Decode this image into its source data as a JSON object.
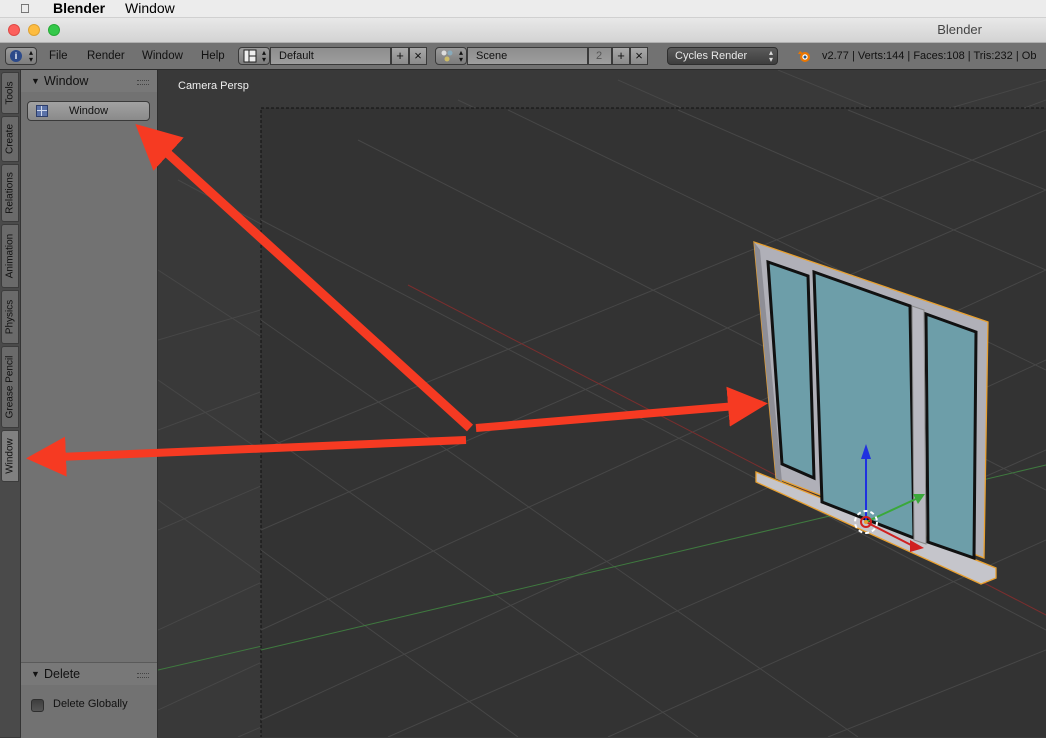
{
  "mac_menubar": {
    "app_name": "Blender",
    "menu_window": "Window"
  },
  "window": {
    "title": "Blender"
  },
  "info_header": {
    "menus": [
      "File",
      "Render",
      "Window",
      "Help"
    ],
    "layout_name": "Default",
    "scene_name": "Scene",
    "scene_users": "2",
    "render_engine": "Cycles Render",
    "stats": "v2.77 | Verts:144 | Faces:108 | Tris:232 | Ob"
  },
  "tool_tabs": [
    "Tools",
    "Create",
    "Relations",
    "Animation",
    "Physics",
    "Grease Pencil",
    "Window"
  ],
  "active_tab": "Window",
  "window_panel": {
    "title": "Window",
    "button_label": "Window"
  },
  "delete_panel": {
    "title": "Delete",
    "option_label": "Delete Globally",
    "option_checked": false
  },
  "viewport": {
    "label": "Camera Persp"
  },
  "colors": {
    "viewport_bg": "#393939",
    "panel_bg": "#727272",
    "glass": "#6d9ea9",
    "frame": "#b0b0b8",
    "selection_outline": "#e8a030",
    "annotation_arrow": "#f63a22",
    "axis_x": "#d02020",
    "axis_y": "#3aa83a",
    "axis_z": "#2030e0"
  }
}
